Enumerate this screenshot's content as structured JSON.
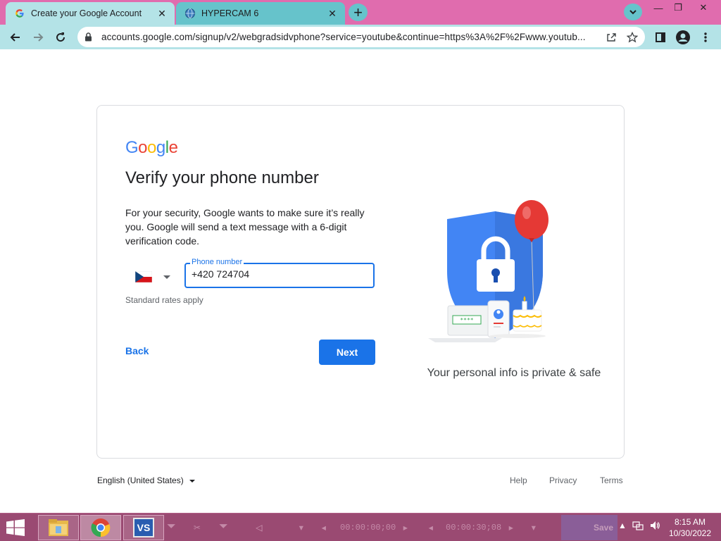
{
  "browser": {
    "tabs": [
      {
        "title": "Create your Google Account",
        "active": true
      },
      {
        "title": "HYPERCAM 6",
        "active": false
      }
    ],
    "url": "accounts.google.com/signup/v2/webgradsidvphone?service=youtube&continue=https%3A%2F%2Fwww.youtub...",
    "icons": [
      "back-arrow",
      "forward-arrow",
      "reload",
      "lock",
      "share",
      "star",
      "sidepanel",
      "profile",
      "more-vertical"
    ]
  },
  "page": {
    "logo_letters": [
      "G",
      "o",
      "o",
      "g",
      "l",
      "e"
    ],
    "logo_colors": [
      "#4285F4",
      "#EA4335",
      "#FBBC05",
      "#4285F4",
      "#34A853",
      "#EA4335"
    ],
    "heading": "Verify your phone number",
    "description": "For your security, Google wants to make sure it’s really you. Google will send a text message with a 6-digit verification code.",
    "country_flag": "czech-flag",
    "phone_label": "Phone number",
    "phone_value": "+420 724704",
    "rates_note": "Standard rates apply",
    "back_label": "Back",
    "next_label": "Next",
    "caption": "Your personal info is private & safe",
    "illustration_code": "****",
    "accent_color": "#1a73e8"
  },
  "footer": {
    "language": "English (United States)",
    "links": [
      "Help",
      "Privacy",
      "Terms"
    ]
  },
  "taskbar": {
    "apps": [
      "file-explorer",
      "chrome",
      "hypercam"
    ],
    "hypercam_app_label": "VS",
    "hypercam_time_1": "00:00:00;00",
    "hypercam_time_2": "00:00:30;08",
    "hypercam_save": "Save",
    "clock_time": "8:15 AM",
    "clock_date": "10/30/2022"
  }
}
